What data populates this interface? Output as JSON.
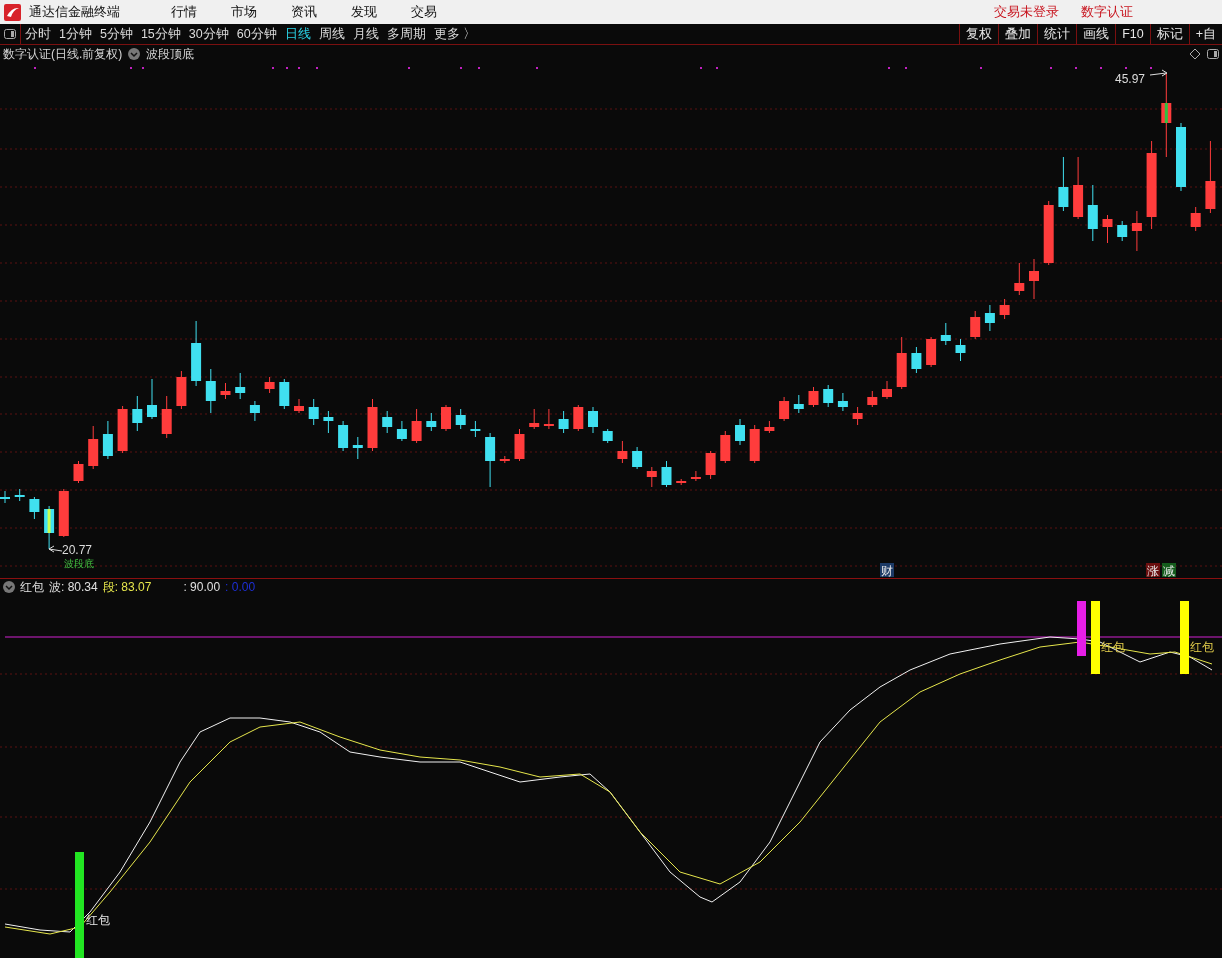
{
  "app": {
    "title": "通达信金融终端",
    "menu": [
      "行情",
      "市场",
      "资讯",
      "发现",
      "交易"
    ],
    "account_links": [
      "交易未登录",
      "数字认证"
    ]
  },
  "toolbar": {
    "periods": [
      {
        "label": "分时",
        "selected": false
      },
      {
        "label": "1分钟",
        "selected": false
      },
      {
        "label": "5分钟",
        "selected": false
      },
      {
        "label": "15分钟",
        "selected": false
      },
      {
        "label": "30分钟",
        "selected": false
      },
      {
        "label": "60分钟",
        "selected": false
      },
      {
        "label": "日线",
        "selected": true
      },
      {
        "label": "周线",
        "selected": false
      },
      {
        "label": "月线",
        "selected": false
      },
      {
        "label": "多周期",
        "selected": false
      },
      {
        "label": "更多 〉",
        "selected": false
      }
    ],
    "actions": [
      "复权",
      "叠加",
      "统计",
      "画线",
      "F10",
      "标记",
      "+自"
    ]
  },
  "main_chart": {
    "title": "数字认证(日线.前复权)",
    "indicator": "波段顶底",
    "high_label": "45.97",
    "low_label": "20.77",
    "low_marker": "波段底",
    "event_markers": [
      {
        "text": "财",
        "color": "#1c3a66"
      },
      {
        "text": "涨",
        "color": "#6b0f0f"
      },
      {
        "text": "减",
        "color": "#145c1c"
      }
    ]
  },
  "sub_chart": {
    "name": "红包",
    "readings": [
      {
        "text": "波: 80.34",
        "color": "#e0e0e0"
      },
      {
        "text": "段: 83.07",
        "color": "#e6e64c"
      },
      {
        "text": ": 90.00",
        "color": "#e0e0e0"
      },
      {
        "text": ": 0.00",
        "color": "#1d2fd6"
      }
    ],
    "signals": [
      {
        "color": "#22e622",
        "label": "红包"
      },
      {
        "color": "#e61ee6"
      },
      {
        "color": "#ffff00",
        "label": "红包"
      },
      {
        "color": "#ffff00",
        "label": "红包"
      }
    ]
  }
}
